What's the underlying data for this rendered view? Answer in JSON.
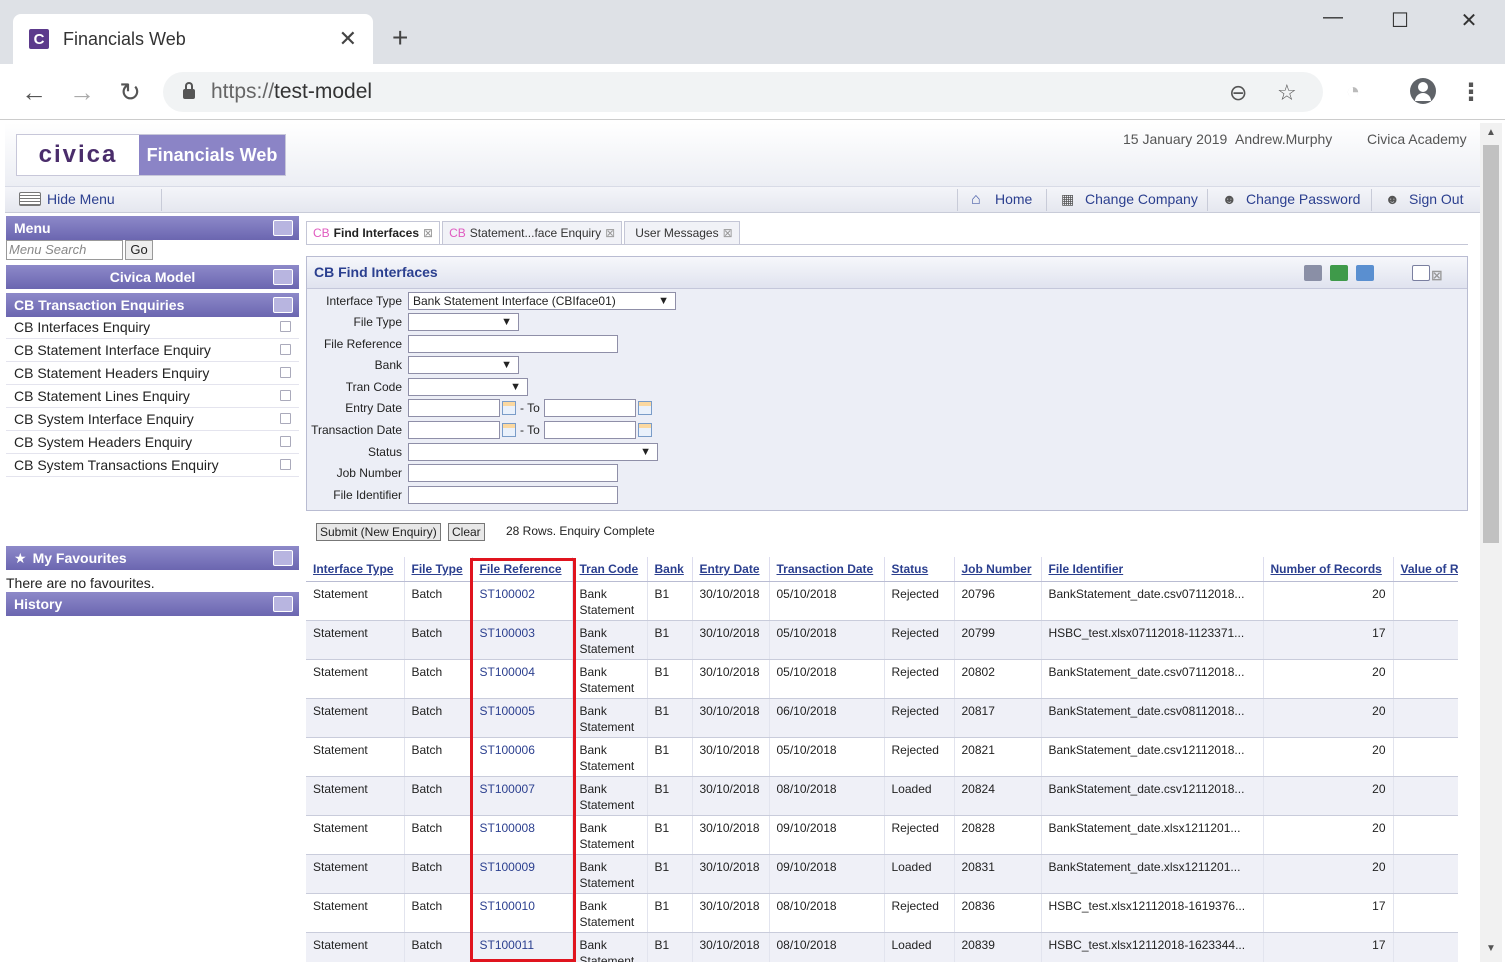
{
  "browser": {
    "tab_title": "Financials Web",
    "favicon_letter": "C",
    "url_scheme": "https://",
    "url_host": "test-model"
  },
  "header": {
    "logo_text": "civica",
    "product_name": "Financials Web",
    "date": "15 January 2019",
    "user": "Andrew.Murphy",
    "company": "Civica Academy"
  },
  "menubar": {
    "hide_menu": "Hide Menu",
    "home": "Home",
    "change_company": "Change Company",
    "change_password": "Change Password",
    "sign_out": "Sign Out"
  },
  "sidebar": {
    "menu_title": "Menu",
    "search_placeholder": "Menu Search",
    "go_label": "Go",
    "model_title": "Civica Model",
    "section_title": "CB Transaction Enquiries",
    "items": [
      "CB Interfaces Enquiry",
      "CB Statement Interface Enquiry",
      "CB Statement Headers Enquiry",
      "CB Statement Lines Enquiry",
      "CB System Interface Enquiry",
      "CB System Headers Enquiry",
      "CB System Transactions Enquiry"
    ],
    "favourites_title": "My Favourites",
    "no_favourites": "There are no favourites.",
    "history_title": "History"
  },
  "content_tabs": [
    {
      "prefix": "CB",
      "label": "Find Interfaces"
    },
    {
      "prefix": "CB",
      "label": "Statement...face Enquiry"
    },
    {
      "prefix": "",
      "label": "User Messages"
    }
  ],
  "enquiry": {
    "title": "CB Find Interfaces",
    "labels": {
      "interface_type": "Interface Type",
      "file_type": "File Type",
      "file_reference": "File Reference",
      "bank": "Bank",
      "tran_code": "Tran Code",
      "entry_date": "Entry Date",
      "transaction_date": "Transaction Date",
      "status": "Status",
      "job_number": "Job Number",
      "file_identifier": "File Identifier",
      "to": "- To"
    },
    "interface_type_value": "Bank Statement Interface (CBIface01)",
    "submit_label": "Submit (New Enquiry)",
    "clear_label": "Clear",
    "status_message": "28 Rows. Enquiry Complete"
  },
  "results": {
    "columns": [
      "Interface Type",
      "File Type",
      "File Reference",
      "Tran Code",
      "Bank",
      "Entry Date",
      "Transaction Date",
      "Status",
      "Job Number",
      "File Identifier",
      "Number of Records",
      "Value of R"
    ],
    "rows": [
      [
        "Statement",
        "Batch",
        "ST100002",
        "Bank Statement",
        "B1",
        "30/10/2018",
        "05/10/2018",
        "Rejected",
        "20796",
        "BankStatement_date.csv07112018...",
        "20",
        ""
      ],
      [
        "Statement",
        "Batch",
        "ST100003",
        "Bank Statement",
        "B1",
        "30/10/2018",
        "05/10/2018",
        "Rejected",
        "20799",
        "HSBC_test.xlsx07112018-1123371...",
        "17",
        ""
      ],
      [
        "Statement",
        "Batch",
        "ST100004",
        "Bank Statement",
        "B1",
        "30/10/2018",
        "05/10/2018",
        "Rejected",
        "20802",
        "BankStatement_date.csv07112018...",
        "20",
        ""
      ],
      [
        "Statement",
        "Batch",
        "ST100005",
        "Bank Statement",
        "B1",
        "30/10/2018",
        "06/10/2018",
        "Rejected",
        "20817",
        "BankStatement_date.csv08112018...",
        "20",
        ""
      ],
      [
        "Statement",
        "Batch",
        "ST100006",
        "Bank Statement",
        "B1",
        "30/10/2018",
        "05/10/2018",
        "Rejected",
        "20821",
        "BankStatement_date.csv12112018...",
        "20",
        ""
      ],
      [
        "Statement",
        "Batch",
        "ST100007",
        "Bank Statement",
        "B1",
        "30/10/2018",
        "08/10/2018",
        "Loaded",
        "20824",
        "BankStatement_date.csv12112018...",
        "20",
        ""
      ],
      [
        "Statement",
        "Batch",
        "ST100008",
        "Bank Statement",
        "B1",
        "30/10/2018",
        "09/10/2018",
        "Rejected",
        "20828",
        "BankStatement_date.xlsx1211201...",
        "20",
        ""
      ],
      [
        "Statement",
        "Batch",
        "ST100009",
        "Bank Statement",
        "B1",
        "30/10/2018",
        "09/10/2018",
        "Loaded",
        "20831",
        "BankStatement_date.xlsx1211201...",
        "20",
        ""
      ],
      [
        "Statement",
        "Batch",
        "ST100010",
        "Bank Statement",
        "B1",
        "30/10/2018",
        "08/10/2018",
        "Rejected",
        "20836",
        "HSBC_test.xlsx12112018-1619376...",
        "17",
        ""
      ],
      [
        "Statement",
        "Batch",
        "ST100011",
        "Bank Statement",
        "B1",
        "30/10/2018",
        "08/10/2018",
        "Loaded",
        "20839",
        "HSBC_test.xlsx12112018-1623344...",
        "17",
        ""
      ]
    ]
  },
  "colors": {
    "accent": "#2b3f8f",
    "panel_header": "#7a76bd",
    "highlight_box": "#e0141e"
  }
}
